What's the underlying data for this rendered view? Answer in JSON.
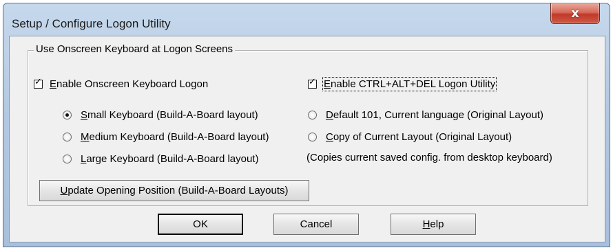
{
  "window": {
    "title": "Setup / Configure Logon Utility",
    "close_glyph": "x"
  },
  "group": {
    "legend": "Use Onscreen Keyboard at Logon Screens"
  },
  "checkboxes": [
    {
      "prefix": "",
      "accel": "E",
      "rest": "nable Onscreen Keyboard Logon",
      "checked": true
    },
    {
      "prefix": "",
      "accel": "E",
      "rest": "nable CTRL+ALT+DEL Logon Utility",
      "checked": true
    }
  ],
  "radios_left": [
    {
      "prefix": "",
      "accel": "S",
      "rest": "mall Keyboard (Build-A-Board layout)",
      "selected": true
    },
    {
      "prefix": "",
      "accel": "M",
      "rest": "edium Keyboard (Build-A-Board layout)",
      "selected": false
    },
    {
      "prefix": "",
      "accel": "L",
      "rest": "arge Keyboard (Build-A-Board layout)",
      "selected": false
    }
  ],
  "radios_right": [
    {
      "prefix": "",
      "accel": "D",
      "rest": "efault 101, Current language (Original Layout)",
      "selected": false
    },
    {
      "prefix": "",
      "accel": "C",
      "rest": "opy of Current Layout (Original Layout)",
      "selected": false
    }
  ],
  "note": "(Copies current saved config. from desktop keyboard)",
  "buttons": {
    "update": {
      "prefix": "",
      "accel": "U",
      "rest": "pdate Opening Position (Build-A-Board Layouts)"
    },
    "ok": {
      "label": "OK"
    },
    "cancel": {
      "label": "Cancel"
    },
    "help": {
      "prefix": "",
      "accel": "H",
      "rest": "elp"
    }
  },
  "colors": {
    "frame": "#b3c9e2",
    "client": "#f0f0f0",
    "close_button": "#c1392b"
  }
}
